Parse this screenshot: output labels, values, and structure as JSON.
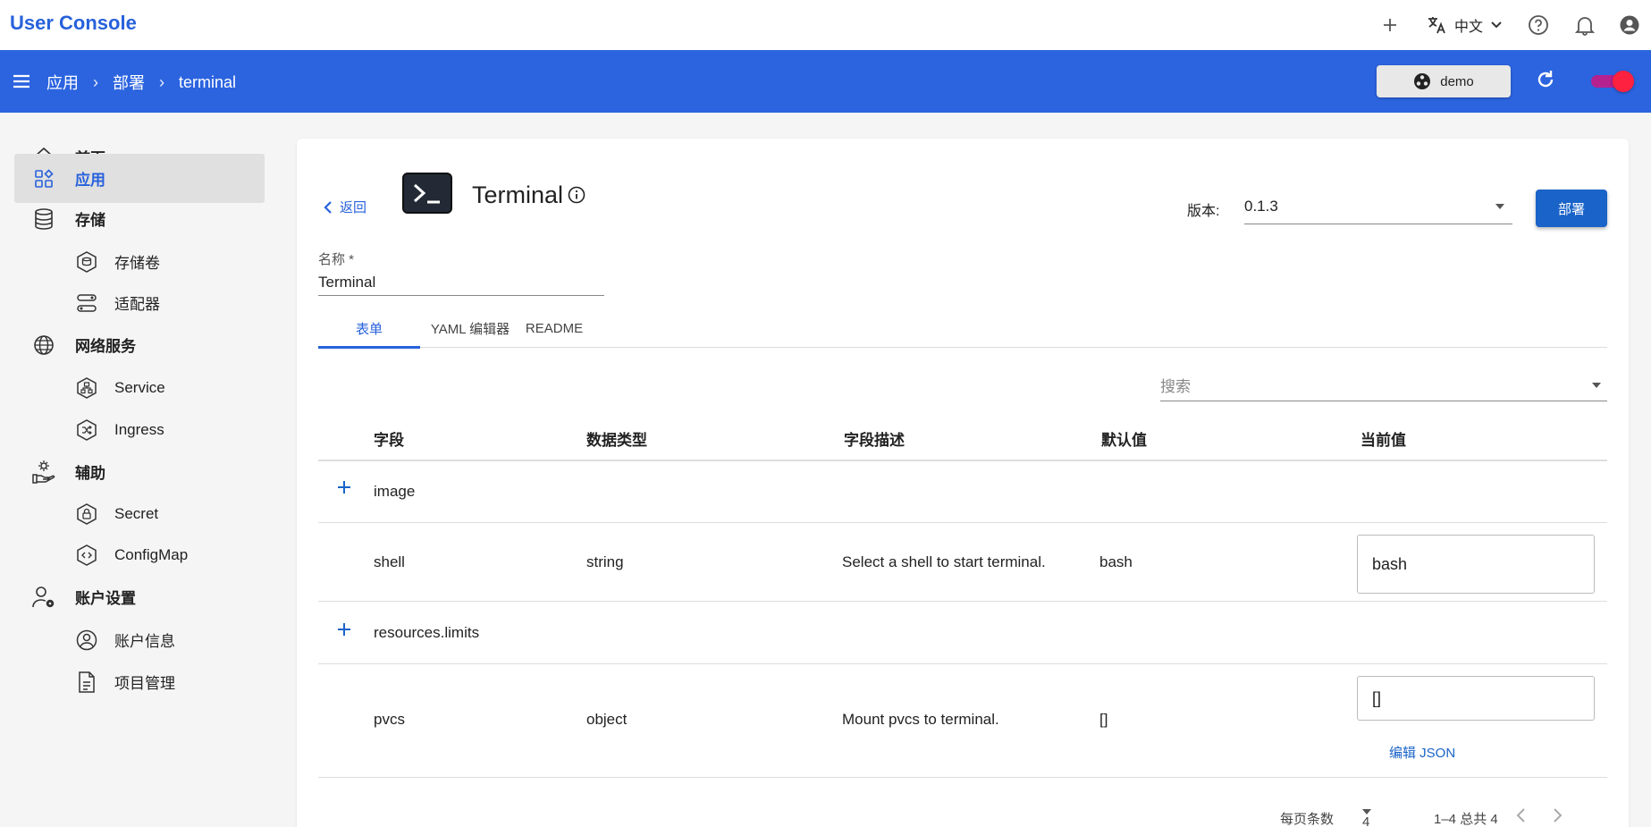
{
  "app": {
    "title": "User Console"
  },
  "topbar": {
    "language": "中文"
  },
  "breadcrumb": {
    "items": [
      "应用",
      "部署",
      "terminal"
    ]
  },
  "namespace": {
    "label": "demo"
  },
  "sidebar": {
    "items": [
      {
        "label": "首页",
        "icon": "home-icon",
        "level": 0
      },
      {
        "label": "应用",
        "icon": "apps-icon",
        "level": 0,
        "active": true
      },
      {
        "label": "存储",
        "icon": "database-icon",
        "level": 0
      },
      {
        "label": "存储卷",
        "icon": "volume-icon",
        "level": 1
      },
      {
        "label": "适配器",
        "icon": "adapter-icon",
        "level": 1
      },
      {
        "label": "网络服务",
        "icon": "globe-icon",
        "level": 0
      },
      {
        "label": "Service",
        "icon": "service-icon",
        "level": 1
      },
      {
        "label": "Ingress",
        "icon": "ingress-icon",
        "level": 1
      },
      {
        "label": "辅助",
        "icon": "helper-icon",
        "level": 0
      },
      {
        "label": "Secret",
        "icon": "secret-icon",
        "level": 1
      },
      {
        "label": "ConfigMap",
        "icon": "configmap-icon",
        "level": 1
      },
      {
        "label": "账户设置",
        "icon": "account-settings-icon",
        "level": 0
      },
      {
        "label": "账户信息",
        "icon": "account-info-icon",
        "level": 1
      },
      {
        "label": "项目管理",
        "icon": "project-icon",
        "level": 1
      }
    ]
  },
  "page": {
    "back_label": "返回",
    "app_name": "Terminal",
    "version_label": "版本:",
    "version_value": "0.1.3",
    "deploy_label": "部署",
    "name_label": "名称 *",
    "name_value": "Terminal",
    "tabs": [
      "表单",
      "YAML 编辑器",
      "README"
    ],
    "search_placeholder": "搜索"
  },
  "table": {
    "headers": [
      "字段",
      "数据类型",
      "字段描述",
      "默认值",
      "当前值"
    ],
    "rows": [
      {
        "field": "image",
        "expandable": true
      },
      {
        "field": "shell",
        "type": "string",
        "description": "Select a shell to start terminal.",
        "default": "bash",
        "current": "bash"
      },
      {
        "field": "resources.limits",
        "expandable": true
      },
      {
        "field": "pvcs",
        "type": "object",
        "description": "Mount pvcs to terminal.",
        "default": "[]",
        "current": "[]",
        "edit_label": "编辑 JSON"
      }
    ]
  },
  "pagination": {
    "rows_per_page_label": "每页条数",
    "rows_per_page": "4",
    "range": "1–4 总共 4"
  },
  "colors": {
    "brand": "#2761db",
    "navbar": "#2c64e0",
    "primary_button": "#1a63c9"
  }
}
